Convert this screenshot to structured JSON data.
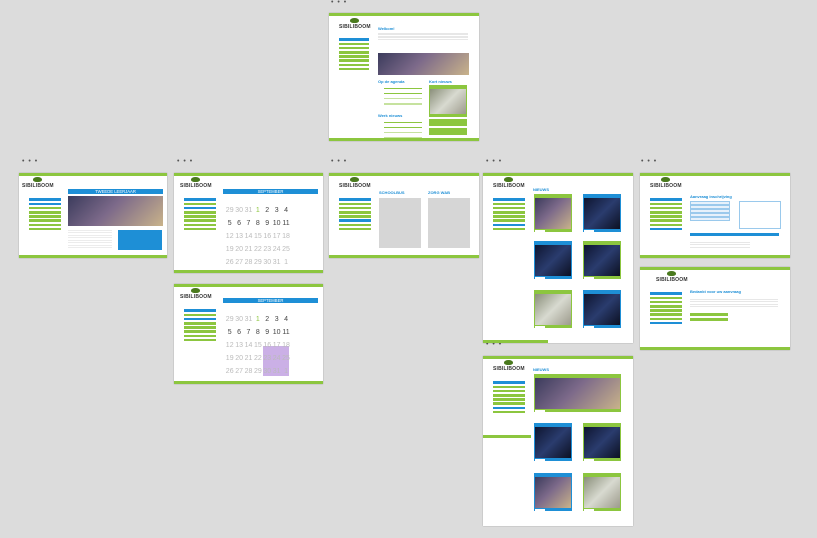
{
  "canvas": {
    "background": "#dcdcdc"
  },
  "colors": {
    "green": "#8cc63f",
    "blue": "#1e8fd6"
  },
  "ellipsis": "• • •",
  "logo_text": "SIBILIBOOM",
  "boards": {
    "home": {
      "title": "Welkom!",
      "agenda_title": "Op de agenda",
      "news_title": "Werk nieuws",
      "right_title": "Kort nieuws"
    },
    "photo_page": {
      "banner": "TWEEDE LEERJAAR"
    },
    "calendar_1": {
      "month": "SEPTEMBER"
    },
    "calendar_2": {
      "month": "SEPTEMBER"
    },
    "columns": {
      "left_title": "SCHOOLBUS",
      "right_title": "ZORG WAB"
    },
    "news_1": {
      "title": "NIEUWS"
    },
    "news_2": {
      "title": "NIEUWS"
    },
    "form": {
      "title": "Aanvraag inschrijving"
    },
    "thanks": {
      "title": "Bedankt voor uw aanvraag"
    }
  },
  "calendar": {
    "weeks": [
      [
        "29",
        "30",
        "31",
        "1",
        "2",
        "3",
        "4"
      ],
      [
        "5",
        "6",
        "7",
        "8",
        "9",
        "10",
        "11"
      ],
      [
        "12",
        "13",
        "14",
        "15",
        "16",
        "17",
        "18"
      ],
      [
        "19",
        "20",
        "21",
        "22",
        "23",
        "24",
        "25"
      ],
      [
        "26",
        "27",
        "28",
        "29",
        "30",
        "31",
        "1"
      ]
    ]
  }
}
